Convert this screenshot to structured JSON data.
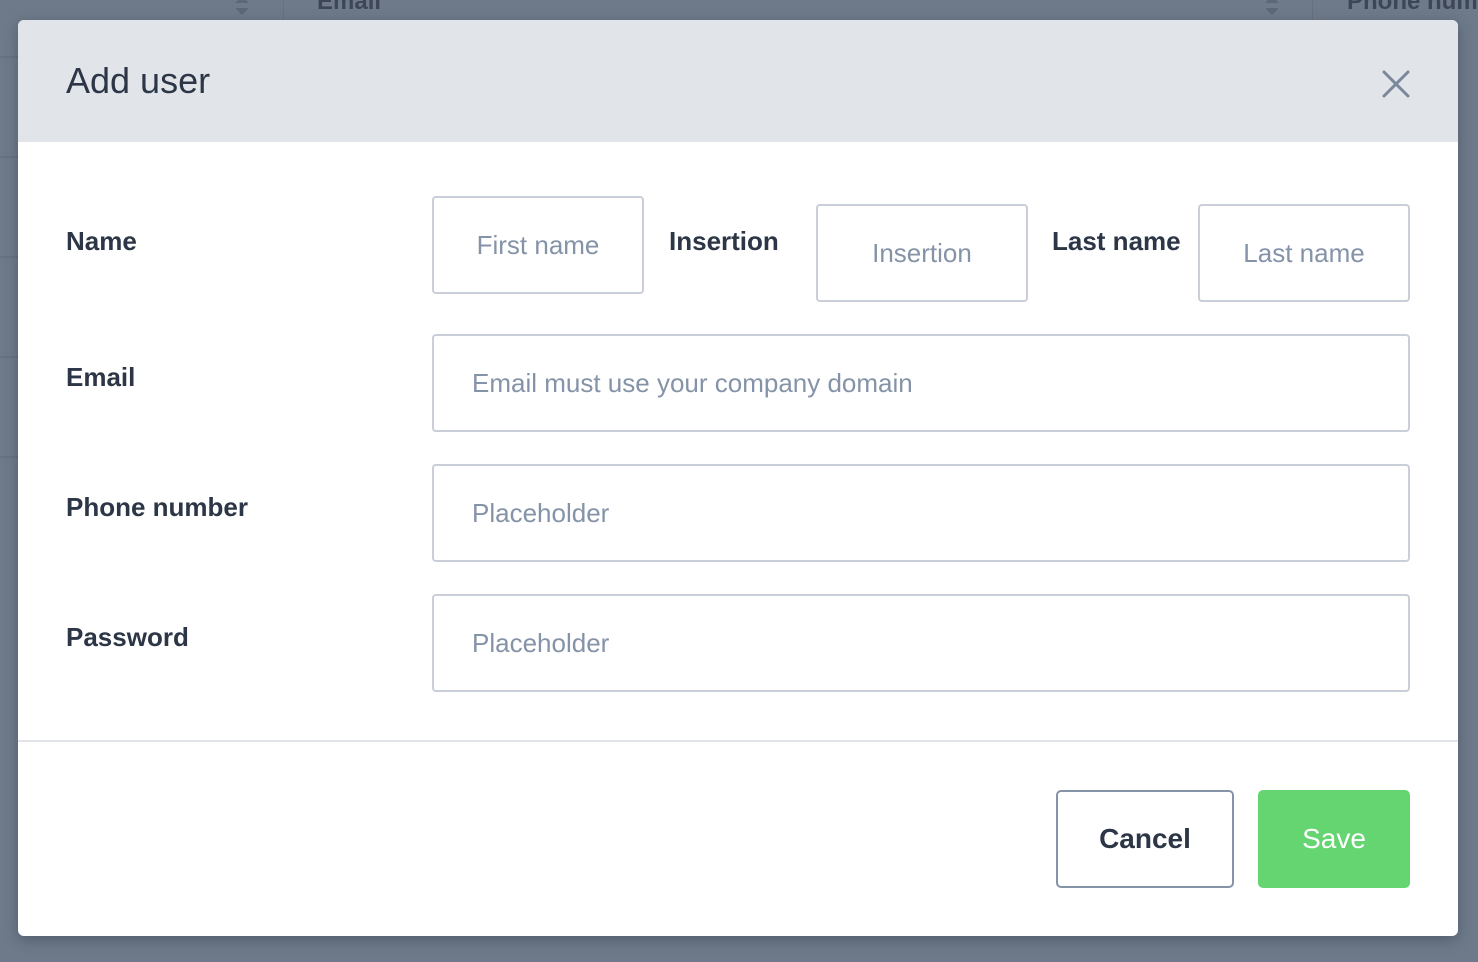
{
  "background_table": {
    "columns": [
      {
        "label": "Email"
      },
      {
        "label": "Phone num"
      }
    ]
  },
  "modal": {
    "title": "Add user",
    "close_icon": "close-icon",
    "fields": {
      "name": {
        "label": "Name",
        "first_name_placeholder": "First name",
        "insertion_label": "Insertion",
        "insertion_placeholder": "Insertion",
        "last_name_label": "Last name",
        "last_name_placeholder": "Last name"
      },
      "email": {
        "label": "Email",
        "placeholder": "Email must use your company domain"
      },
      "phone": {
        "label": "Phone number",
        "placeholder": "Placeholder"
      },
      "password": {
        "label": "Password",
        "placeholder": "Placeholder"
      }
    },
    "footer": {
      "cancel_label": "Cancel",
      "save_label": "Save"
    }
  },
  "colors": {
    "overlay": "#6e7a8a",
    "header_bg": "#e1e5ea",
    "text": "#2c3646",
    "placeholder": "#8593a8",
    "save_green": "#65d572"
  }
}
